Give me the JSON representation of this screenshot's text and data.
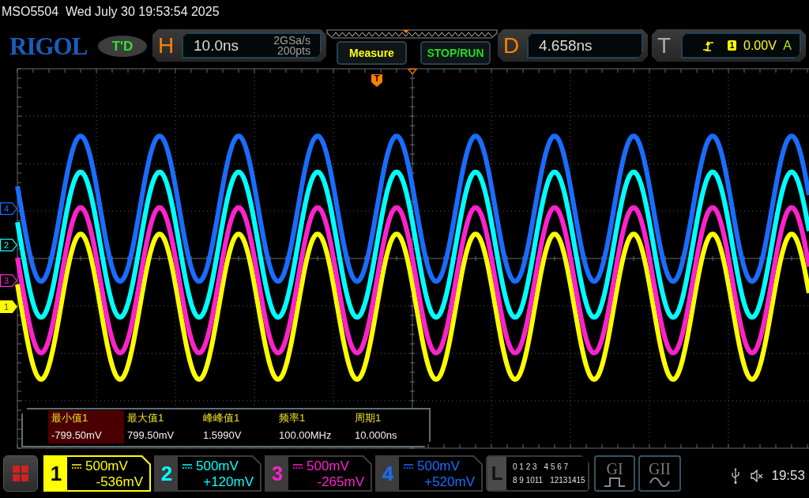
{
  "status_line": {
    "model": "MSO5504",
    "datetime": "Wed July 30 19:53:54 2025"
  },
  "header": {
    "logo": "RIGOL",
    "mode_badge": "T'D",
    "horizontal": {
      "letter": "H",
      "timebase": "10.0ns",
      "sample_rate": "2GSa/s",
      "memory_depth": "200pts"
    },
    "buttons": [
      {
        "label": "Measure",
        "color": "#ffff00"
      },
      {
        "label": "STOP/RUN",
        "color": "#22dd22"
      }
    ],
    "delay": {
      "letter": "D",
      "value": "4.658ns"
    },
    "trigger": {
      "letter": "T",
      "source": "1",
      "level": "0.00V",
      "mode": "A"
    }
  },
  "display": {
    "trigger_marker": "T",
    "channel_markers": [
      {
        "label": "4",
        "color": "#1a6dff",
        "selected": false
      },
      {
        "label": "2",
        "color": "#00ffff",
        "selected": false
      },
      {
        "label": "3",
        "color": "#ff22cc",
        "selected": false
      },
      {
        "label": "1",
        "color": "#ffff00",
        "selected": true
      }
    ]
  },
  "measurements": [
    {
      "label": "最小值1",
      "value": "-799.50mV",
      "selected": true
    },
    {
      "label": "最大值1",
      "value": "799.50mV",
      "selected": false
    },
    {
      "label": "峰峰值1",
      "value": "1.5990V",
      "selected": false
    },
    {
      "label": "频率1",
      "value": "100.00MHz",
      "selected": false
    },
    {
      "label": "周期1",
      "value": "10.000ns",
      "selected": false
    }
  ],
  "channels": [
    {
      "number": "1",
      "color": "#ffff00",
      "selected": true,
      "scale": "500mV",
      "offset": "-536mV"
    },
    {
      "number": "2",
      "color": "#00ffff",
      "selected": false,
      "scale": "500mV",
      "offset": "+120mV"
    },
    {
      "number": "3",
      "color": "#ff22cc",
      "selected": false,
      "scale": "500mV",
      "offset": "-265mV"
    },
    {
      "number": "4",
      "color": "#1a6dff",
      "selected": false,
      "scale": "500mV",
      "offset": "+520mV"
    }
  ],
  "logic": {
    "letter": "L",
    "rows": [
      [
        "0 1 2 3",
        "4 5 6 7"
      ],
      [
        "8 9 1011",
        "12131415"
      ]
    ]
  },
  "generators": [
    {
      "label": "GI",
      "kind": "pulse"
    },
    {
      "label": "GII",
      "kind": "sine"
    }
  ],
  "status_bar": {
    "time": "19:53"
  }
}
